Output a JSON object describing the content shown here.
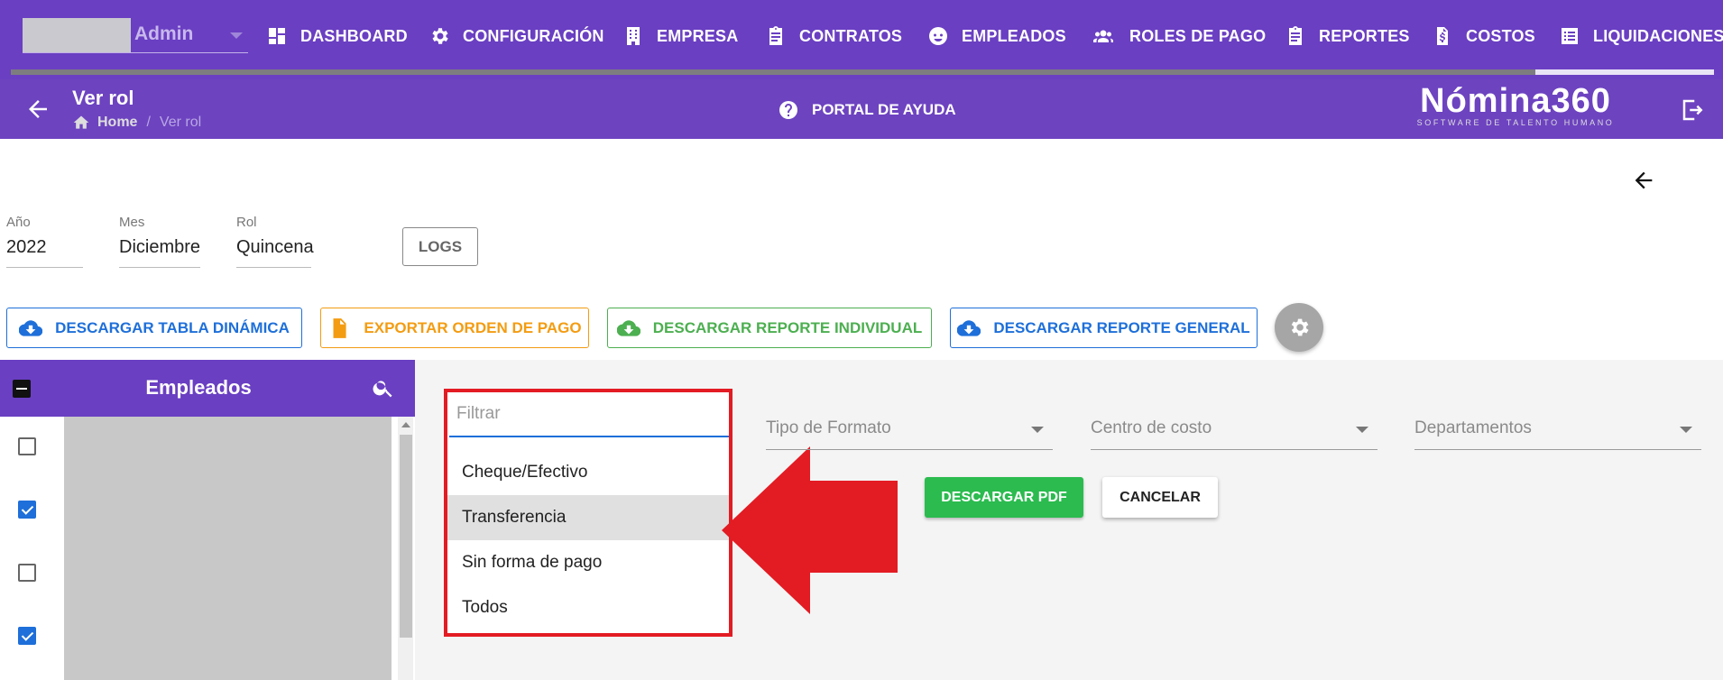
{
  "colors": {
    "nav_purple": "#6a3fc2",
    "subheader_purple": "#6d43c0",
    "blue": "#1e6fd9",
    "orange": "#f39c12",
    "green": "#4caf50",
    "download_pdf_green": "#2bbb4f",
    "highlight_red": "#e31b23"
  },
  "user": {
    "name": "Admin"
  },
  "nav": {
    "items": [
      {
        "label": "DASHBOARD",
        "icon": "dashboard-icon"
      },
      {
        "label": "CONFIGURACIÓN",
        "icon": "gear-icon"
      },
      {
        "label": "EMPRESA",
        "icon": "building-icon"
      },
      {
        "label": "CONTRATOS",
        "icon": "clipboard-icon"
      },
      {
        "label": "EMPLEADOS",
        "icon": "face-icon"
      },
      {
        "label": "ROLES DE PAGO",
        "icon": "group-icon"
      },
      {
        "label": "REPORTES",
        "icon": "clipboard-icon"
      },
      {
        "label": "COSTOS",
        "icon": "dollar-document-icon"
      },
      {
        "label": "LIQUIDACIONES",
        "icon": "list-icon"
      }
    ]
  },
  "header": {
    "title": "Ver rol",
    "breadcrumb": {
      "home": "Home",
      "separator": "/",
      "current": "Ver rol"
    },
    "help_portal": "PORTAL DE AYUDA",
    "brand": {
      "name": "Nómina360",
      "tagline": "SOFTWARE DE TALENTO HUMANO"
    }
  },
  "fields": {
    "anio": {
      "label": "Año",
      "value": "2022"
    },
    "mes": {
      "label": "Mes",
      "value": "Diciembre"
    },
    "rol": {
      "label": "Rol",
      "value": "Quincena"
    }
  },
  "logs_button": "LOGS",
  "actions": {
    "tabla_dinamica": "DESCARGAR TABLA DINÁMICA",
    "orden_pago": "EXPORTAR ORDEN DE PAGO",
    "reporte_individual": "DESCARGAR REPORTE INDIVIDUAL",
    "reporte_general": "DESCARGAR REPORTE GENERAL"
  },
  "employees": {
    "title": "Empleados",
    "rows_checked": [
      false,
      true,
      false,
      true
    ]
  },
  "filter": {
    "placeholder": "Filtrar",
    "options": [
      "Cheque/Efectivo",
      "Transferencia",
      "Sin forma de pago",
      "Todos"
    ],
    "selected": "Transferencia"
  },
  "selects": {
    "tipo_formato": "Tipo de Formato",
    "centro_costo": "Centro de costo",
    "departamentos": "Departamentos"
  },
  "buttons": {
    "download_pdf": "DESCARGAR PDF",
    "cancel": "CANCELAR"
  }
}
